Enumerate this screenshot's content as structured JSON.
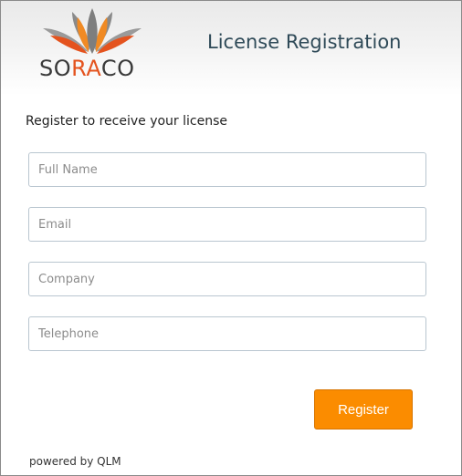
{
  "header": {
    "title": "License Registration",
    "logo": {
      "text_pre": "SO",
      "text_accent": "RA",
      "text_post": "CO",
      "accent_color": "#e4531e",
      "petal_colors": [
        "#8f8f8f",
        "#e4531e",
        "#f08a24"
      ]
    }
  },
  "form": {
    "subtitle": "Register to receive your license",
    "fields": [
      {
        "placeholder": "Full Name",
        "value": ""
      },
      {
        "placeholder": "Email",
        "value": ""
      },
      {
        "placeholder": "Company",
        "value": ""
      },
      {
        "placeholder": "Telephone",
        "value": ""
      }
    ],
    "submit_label": "Register",
    "submit_color": "#fb8c00"
  },
  "footer": {
    "powered_by": "powered by QLM"
  }
}
